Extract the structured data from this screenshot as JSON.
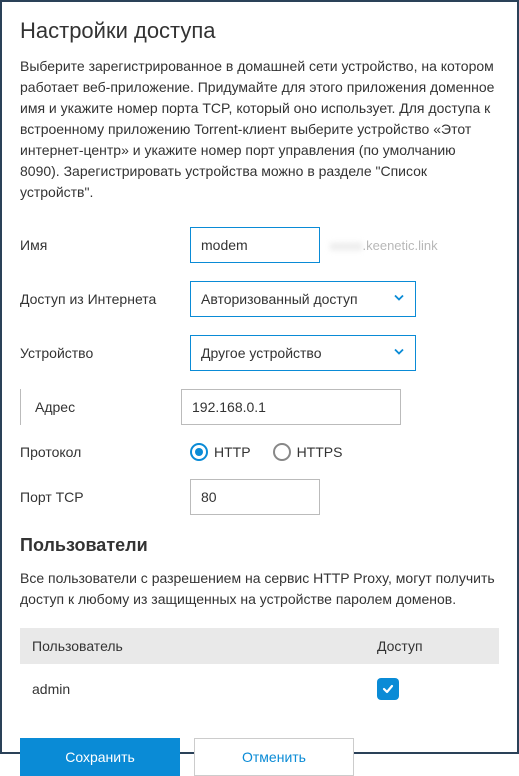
{
  "title": "Настройки доступа",
  "description": "Выберите зарегистрированное в домашней сети устройство, на котором работает веб-приложение. Придумайте для этого приложения доменное имя и укажите номер порта TCP, который оно использует. Для доступа к встроенному приложению Torrent-клиент выберите устройство «Этот интернет-центр» и укажите номер порт управления (по умолчанию 8090). Зарегистрировать устройства можно в разделе \"Список устройств\".",
  "fields": {
    "name_label": "Имя",
    "name_value": "modem",
    "domain_suffix": ".keenetic.link",
    "access_label": "Доступ из Интернета",
    "access_value": "Авторизованный доступ",
    "device_label": "Устройство",
    "device_value": "Другое устройство",
    "address_label": "Адрес",
    "address_value": "192.168.0.1",
    "protocol_label": "Протокол",
    "protocol_http": "HTTP",
    "protocol_https": "HTTPS",
    "protocol_selected": "HTTP",
    "port_label": "Порт TCP",
    "port_value": "80"
  },
  "users_section": {
    "title": "Пользователи",
    "description": "Все пользователи с разрешением на сервис HTTP Proxy, могут получить доступ к любому из защищенных на устройстве паролем доменов.",
    "col_user": "Пользователь",
    "col_access": "Доступ",
    "rows": [
      {
        "user": "admin",
        "access": true
      }
    ]
  },
  "buttons": {
    "save": "Сохранить",
    "cancel": "Отменить"
  }
}
